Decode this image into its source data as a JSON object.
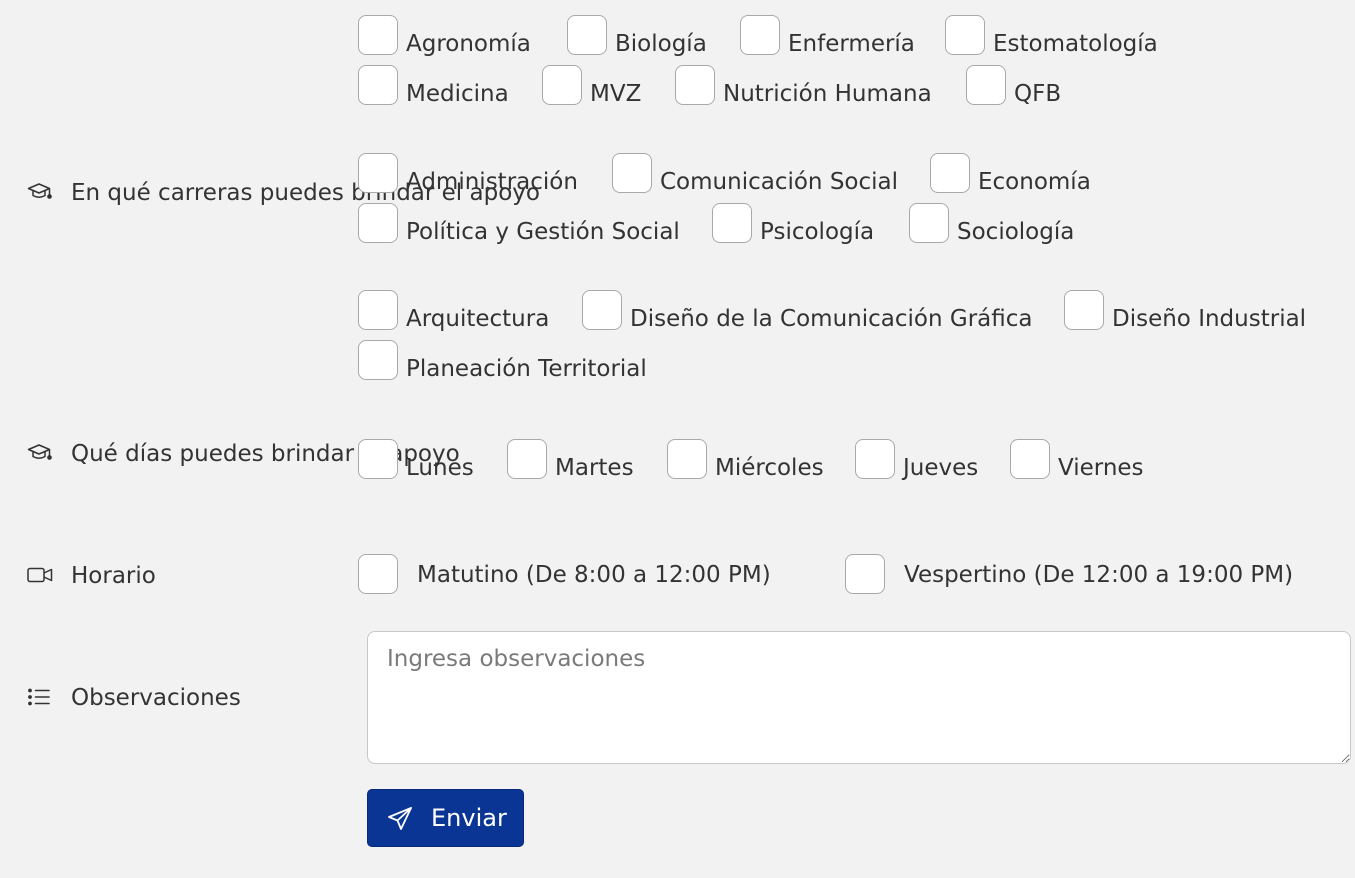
{
  "sections": {
    "carreras_label": "En qué carreras puedes brindar el apoyo",
    "dias_label": "Qué días puedes brindar el apoyo",
    "horario_label": "Horario",
    "observaciones_label": "Observaciones"
  },
  "carreras": {
    "ciencias_salud": [
      "Agronomía",
      "Biología",
      "Enfermería",
      "Estomatología",
      "Medicina",
      "MVZ",
      "Nutrición Humana",
      "QFB"
    ],
    "ciencias_sociales": [
      "Administración",
      "Comunicación Social",
      "Economía",
      "Política y Gestión Social",
      "Psicología",
      "Sociología"
    ],
    "artes_diseno": [
      "Arquitectura",
      "Diseño de la Comunicación Gráfica",
      "Diseño Industrial",
      "Planeación Territorial"
    ]
  },
  "dias": [
    "Lunes",
    "Martes",
    "Miércoles",
    "Jueves",
    "Viernes"
  ],
  "horario": [
    "Matutino (De 8:00 a 12:00 PM)",
    "Vespertino (De 12:00 a 19:00 PM)"
  ],
  "observaciones": {
    "placeholder": "Ingresa observaciones",
    "value": ""
  },
  "submit": {
    "label": "Enviar"
  },
  "icons": {
    "carreras": "graduation-cap-icon",
    "dias": "graduation-cap-icon",
    "horario": "video-camera-icon",
    "observaciones": "list-icon",
    "submit": "send-icon"
  },
  "colors": {
    "background": "#f2f2f2",
    "primary_button": "#0b3595",
    "text": "#333333",
    "placeholder": "#7a7a7a"
  }
}
